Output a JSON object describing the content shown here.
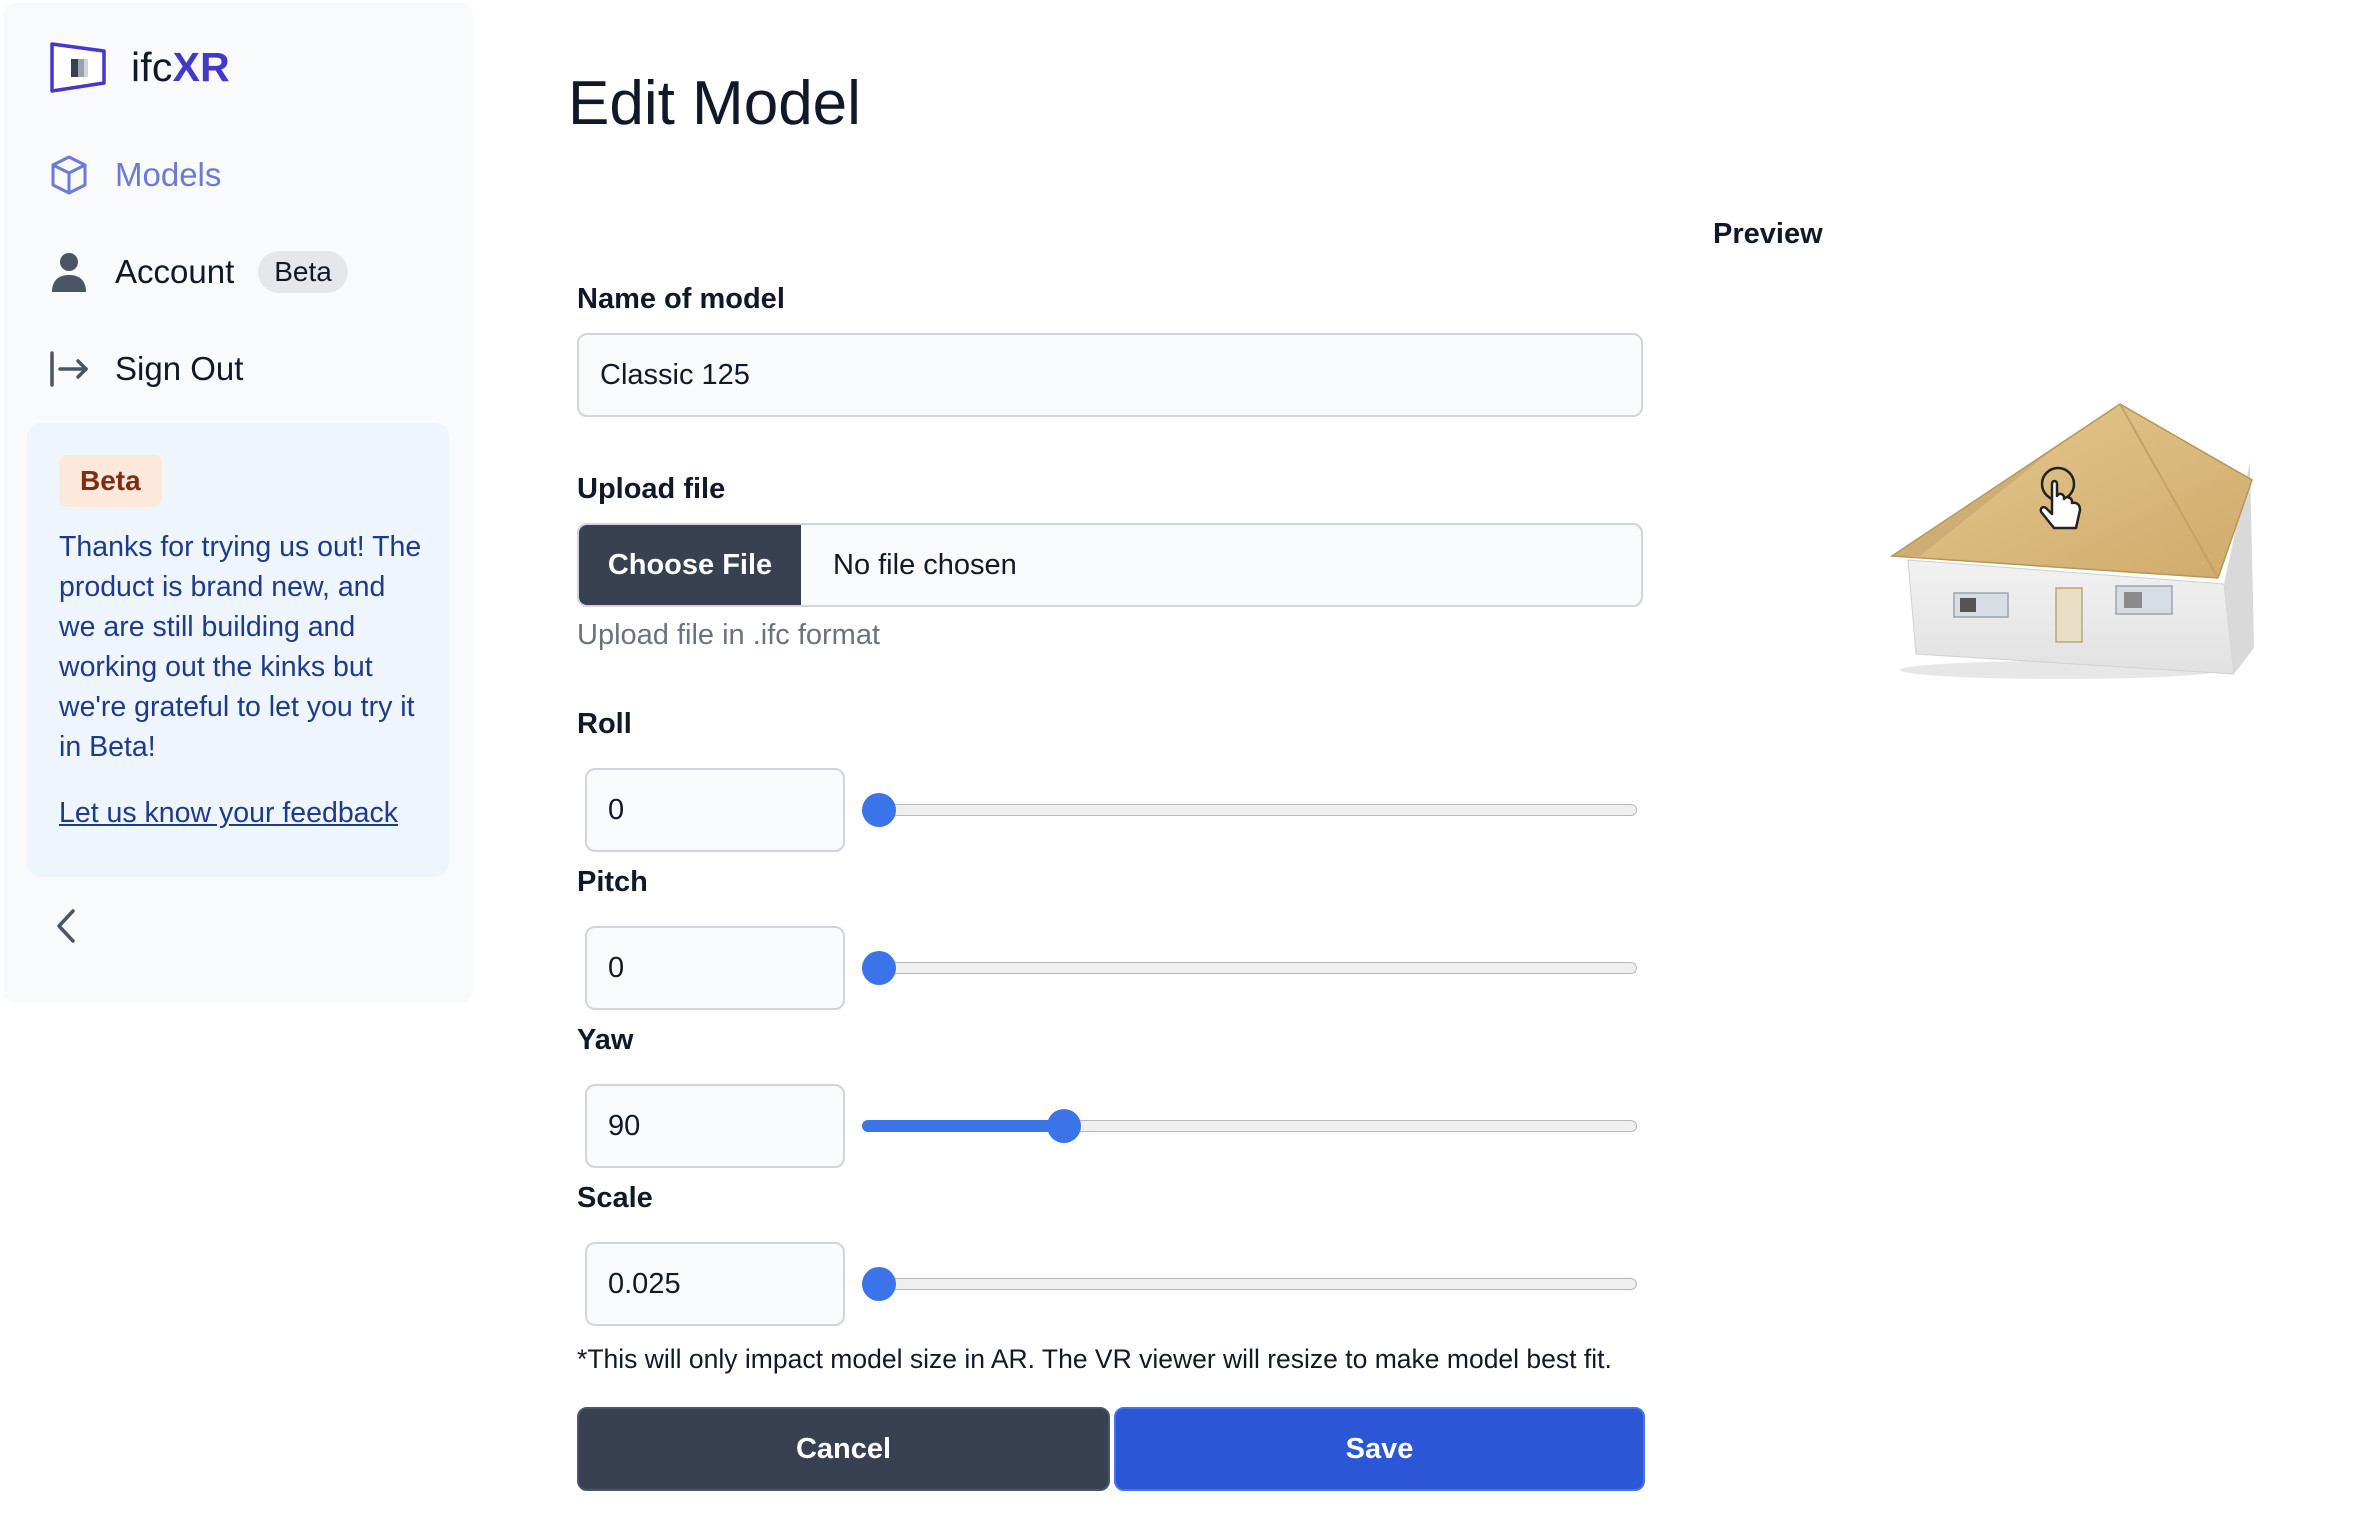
{
  "app": {
    "logo_prefix": "ifc",
    "logo_suffix": "XR"
  },
  "sidebar": {
    "items": [
      {
        "label": "Models",
        "icon": "cube-icon",
        "active": true
      },
      {
        "label": "Account",
        "icon": "user-icon",
        "badge": "Beta"
      },
      {
        "label": "Sign Out",
        "icon": "sign-out-icon"
      }
    ],
    "beta_card": {
      "tag": "Beta",
      "message": "Thanks for trying us out! The product is brand new, and we are still building and working out the kinks but we're grateful to let you try it in Beta!",
      "link": "Let us know your feedback"
    },
    "collapse_icon": "chevron-left-icon"
  },
  "main": {
    "title": "Edit Model",
    "name_label": "Name of model",
    "name_value": "Classic 125",
    "upload_label": "Upload file",
    "upload_button": "Choose File",
    "upload_status": "No file chosen",
    "upload_help": "Upload file in .ifc format",
    "sliders": [
      {
        "label": "Roll",
        "value": "0",
        "fraction": 0.0
      },
      {
        "label": "Pitch",
        "value": "0",
        "fraction": 0.0
      },
      {
        "label": "Yaw",
        "value": "90",
        "fraction": 0.25
      },
      {
        "label": "Scale",
        "value": "0.025",
        "fraction": 0.0
      }
    ],
    "note": "*This will only impact model size in AR. The VR viewer will resize to make model best fit.",
    "cancel_label": "Cancel",
    "save_label": "Save"
  },
  "preview": {
    "label": "Preview",
    "model_icon": "house-model-icon",
    "cursor_icon": "hand-pointer-icon"
  },
  "colors": {
    "accent": "#2b56d5",
    "active_nav": "#6e79d6",
    "slider": "#3b74e8",
    "dark_button": "#374151",
    "logo_accent": "#4338ca"
  }
}
